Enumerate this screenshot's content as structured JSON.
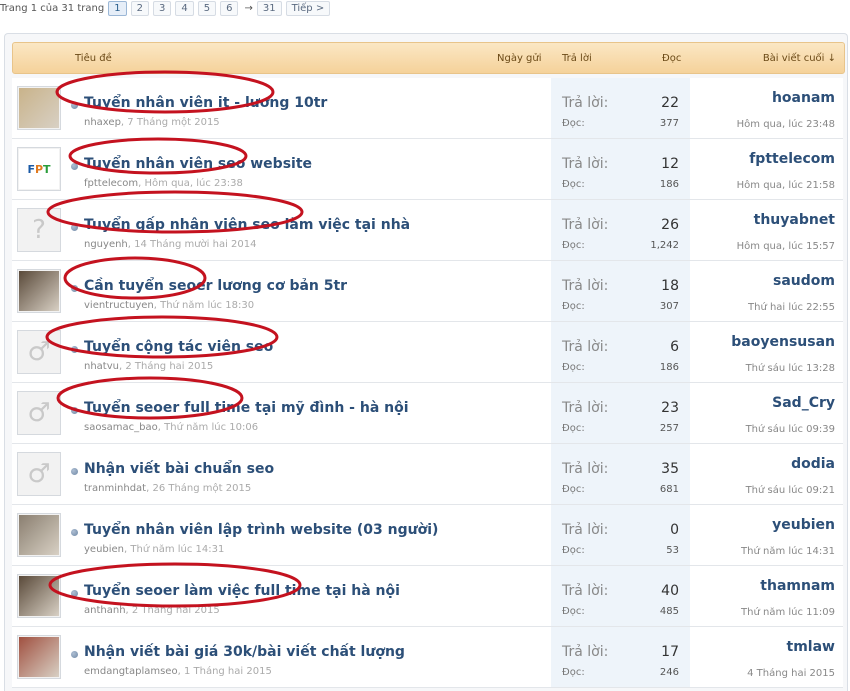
{
  "pager": {
    "info": "Trang 1 của 31 trang",
    "pages": [
      "1",
      "2",
      "3",
      "4",
      "5",
      "6"
    ],
    "arrow": "→",
    "last": "31",
    "next": "Tiếp >"
  },
  "header": {
    "title": "Tiêu đề",
    "date": "Ngày gửi",
    "replies": "Trả lời",
    "views": "Đọc",
    "last_post": "Bài viết cuối ↓"
  },
  "labels": {
    "replies": "Trả lời:",
    "views": "Đọc:"
  },
  "threads": [
    {
      "title": "Tuyển nhân viên it - lương 10tr",
      "author": "nhaxep",
      "date": ", 7 Tháng một 2015",
      "replies": "22",
      "views": "377",
      "last_user": "hoanam",
      "last_time": "Hôm qua, lúc 23:48",
      "avatar": "photo"
    },
    {
      "title": "Tuyển nhân viên seo website",
      "author": "fpttelecom",
      "date": ", Hôm qua, lúc 23:38",
      "replies": "12",
      "views": "186",
      "last_user": "fpttelecom",
      "last_time": "Hôm qua, lúc 21:58",
      "avatar": "fpt"
    },
    {
      "title": "Tuyển gấp nhân viên seo làm việc tại nhà",
      "author": "nguyenh",
      "date": ", 14 Tháng mười hai 2014",
      "replies": "26",
      "views": "1,242",
      "last_user": "thuyabnet",
      "last_time": "Hôm qua, lúc 15:57",
      "avatar": "unknown"
    },
    {
      "title": "Cần tuyển seoer lương cơ bản 5tr",
      "author": "vientructuyen",
      "date": ", Thứ năm lúc 18:30",
      "replies": "18",
      "views": "307",
      "last_user": "saudom",
      "last_time": "Thứ hai lúc 22:55",
      "avatar": "photo"
    },
    {
      "title": "Tuyển cộng tác viên seo",
      "author": "nhatvu",
      "date": ", 2 Tháng hai 2015",
      "replies": "6",
      "views": "186",
      "last_user": "baoyensusan",
      "last_time": "Thứ sáu lúc 13:28",
      "avatar": "male"
    },
    {
      "title": "Tuyển seoer full time tại mỹ đình - hà nội",
      "author": "saosamac_bao",
      "date": ", Thứ năm lúc 10:06",
      "replies": "23",
      "views": "257",
      "last_user": "Sad_Cry",
      "last_time": "Thứ sáu lúc 09:39",
      "avatar": "male"
    },
    {
      "title": "Nhận viết bài chuẩn seo",
      "author": "tranminhdat",
      "date": ", 26 Tháng một 2015",
      "replies": "35",
      "views": "681",
      "last_user": "dodia",
      "last_time": "Thứ sáu lúc 09:21",
      "avatar": "male"
    },
    {
      "title": "Tuyển nhân viên lập trình website (03 người)",
      "author": "yeubien",
      "date": ", Thứ năm lúc 14:31",
      "replies": "0",
      "views": "53",
      "last_user": "yeubien",
      "last_time": "Thứ năm lúc 14:31",
      "avatar": "photo"
    },
    {
      "title": "Tuyển seoer làm việc full time tại hà nội",
      "author": "anthanh",
      "date": ", 2 Tháng hai 2015",
      "replies": "40",
      "views": "485",
      "last_user": "thamnam",
      "last_time": "Thứ năm lúc 11:09",
      "avatar": "photo"
    },
    {
      "title": "Nhận viết bài giá 30k/bài viết chất lượng",
      "author": "emdangtaplamseo",
      "date": ", 1 Tháng hai 2015",
      "replies": "17",
      "views": "246",
      "last_user": "tmlaw",
      "last_time": "4 Tháng hai 2015",
      "avatar": "photo"
    }
  ],
  "colors": {
    "highlight_oval": "#c4121f",
    "title": "#2c4f78",
    "header_bg": "#f5d29a"
  }
}
